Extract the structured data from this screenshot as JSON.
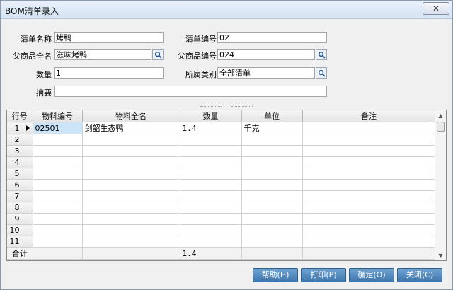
{
  "window": {
    "title": "BOM清单录入",
    "close_label": "✕"
  },
  "form": {
    "list_name_label": "清单名称",
    "list_name_value": "烤鸭",
    "list_no_label": "清单编号",
    "list_no_value": "02",
    "parent_name_label": "父商品全名",
    "parent_name_value": "滋味烤鸭",
    "parent_no_label": "父商品编号",
    "parent_no_value": "024",
    "qty_label": "数量",
    "qty_value": "1",
    "category_label": "所属类别",
    "category_value": "全部清单",
    "summary_label": "摘要",
    "summary_value": ""
  },
  "grid": {
    "headers": [
      "行号",
      "物料编号",
      "物料全名",
      "数量",
      "单位",
      "备注"
    ],
    "rows": [
      {
        "no": "1",
        "code": "02501",
        "name": "剑韶生态鸭",
        "qty": "1.4",
        "unit": "千克",
        "note": ""
      },
      {
        "no": "2",
        "code": "",
        "name": "",
        "qty": "",
        "unit": "",
        "note": ""
      },
      {
        "no": "3",
        "code": "",
        "name": "",
        "qty": "",
        "unit": "",
        "note": ""
      },
      {
        "no": "4",
        "code": "",
        "name": "",
        "qty": "",
        "unit": "",
        "note": ""
      },
      {
        "no": "5",
        "code": "",
        "name": "",
        "qty": "",
        "unit": "",
        "note": ""
      },
      {
        "no": "6",
        "code": "",
        "name": "",
        "qty": "",
        "unit": "",
        "note": ""
      },
      {
        "no": "7",
        "code": "",
        "name": "",
        "qty": "",
        "unit": "",
        "note": ""
      },
      {
        "no": "8",
        "code": "",
        "name": "",
        "qty": "",
        "unit": "",
        "note": ""
      },
      {
        "no": "9",
        "code": "",
        "name": "",
        "qty": "",
        "unit": "",
        "note": ""
      },
      {
        "no": "10",
        "code": "",
        "name": "",
        "qty": "",
        "unit": "",
        "note": ""
      },
      {
        "no": "11",
        "code": "",
        "name": "",
        "qty": "",
        "unit": "",
        "note": ""
      }
    ],
    "total": {
      "label": "合计",
      "qty": "1.4"
    }
  },
  "buttons": {
    "help": "帮助(H)",
    "print": "打印(P)",
    "ok": "确定(O)",
    "close": "关闭(C)"
  },
  "icons": {
    "lookup": "magnifier-icon",
    "current_row": "row-pointer-icon"
  }
}
